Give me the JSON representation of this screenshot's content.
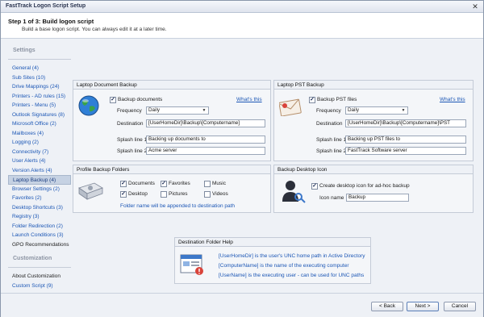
{
  "window": {
    "title": "FastTrack Logon Script Setup",
    "close_glyph": "✕"
  },
  "header": {
    "step_title": "Step 1 of 3: Build logon script",
    "step_desc": "Build a base logon script. You can always edit it at a later time."
  },
  "sidebar": {
    "settings_label": "Settings",
    "items": [
      {
        "label": "General (4)"
      },
      {
        "label": "Sub Sites (10)"
      },
      {
        "label": "Drive Mappings (24)"
      },
      {
        "label": "Printers - AD rules (15)"
      },
      {
        "label": "Printers - Menu (5)"
      },
      {
        "label": "Outlook Signatures (8)"
      },
      {
        "label": "Microsoft Office (2)"
      },
      {
        "label": "Mailboxes (4)"
      },
      {
        "label": "Logging (2)"
      },
      {
        "label": "Connectivity (7)"
      },
      {
        "label": "User Alerts (4)"
      },
      {
        "label": "Version Alerts (4)"
      },
      {
        "label": "Laptop Backup (4)"
      },
      {
        "label": "Browser Settings (2)"
      },
      {
        "label": "Favorites (2)"
      },
      {
        "label": "Desktop Shortcuts (3)"
      },
      {
        "label": "Registry (3)"
      },
      {
        "label": "Folder Redirection (2)"
      },
      {
        "label": "Launch Conditions (3)"
      },
      {
        "label": "GPO Recommendations"
      }
    ],
    "selected_index": 12,
    "customization_label": "Customization",
    "custom_items": [
      {
        "label": "About Customization"
      },
      {
        "label": "Custom Script (9)"
      }
    ]
  },
  "doc_backup": {
    "title": "Laptop Document Backup",
    "checkbox_label": "Backup documents",
    "checked": true,
    "whats_this": "What's this",
    "frequency_label": "Frequency",
    "frequency_value": "Daily",
    "destination_label": "Destination",
    "destination_value": "[UserHomeDir]\\Backup\\[Computername]",
    "splash1_label": "Splash line 1",
    "splash1_value": "Backing up documents to",
    "splash2_label": "Splash line 2",
    "splash2_value": "Acme server"
  },
  "pst_backup": {
    "title": "Laptop PST Backup",
    "checkbox_label": "Backup PST files",
    "checked": true,
    "whats_this": "What's this",
    "frequency_label": "Frequency",
    "frequency_value": "Daily",
    "destination_label": "Destination",
    "destination_value": "[UserHomeDir]\\Backup\\[Computername]\\PST",
    "splash1_label": "Splash line 1",
    "splash1_value": "Backing up PST files to",
    "splash2_label": "Splash line 2",
    "splash2_value": "FastTrack Software server"
  },
  "profile_folders": {
    "title": "Profile Backup Folders",
    "documents": "Documents",
    "favorites": "Favorites",
    "music": "Music",
    "desktop": "Desktop",
    "pictures": "Pictures",
    "videos": "Videos",
    "note": "Folder name will be appended to destination path"
  },
  "desktop_icon": {
    "title": "Backup Desktop Icon",
    "checkbox_label": "Create desktop icon for ad-hoc backup",
    "icon_name_label": "Icon name",
    "icon_name_value": "Backup"
  },
  "help": {
    "title": "Destination Folder Help",
    "line1": "[UserHomeDir] is the user's UNC home path in Active Directory",
    "line2": "[ComputerName] is the name of the executing computer",
    "line3": "[UserName] is the executing user - can be used for UNC paths"
  },
  "footer": {
    "back": "< Back",
    "next": "Next >",
    "cancel": "Cancel"
  },
  "check_glyph": "✓",
  "dropdown_glyph": "▼",
  "colors": {
    "link": "#1b56b5",
    "selected_bg": "#c6d2e3"
  }
}
